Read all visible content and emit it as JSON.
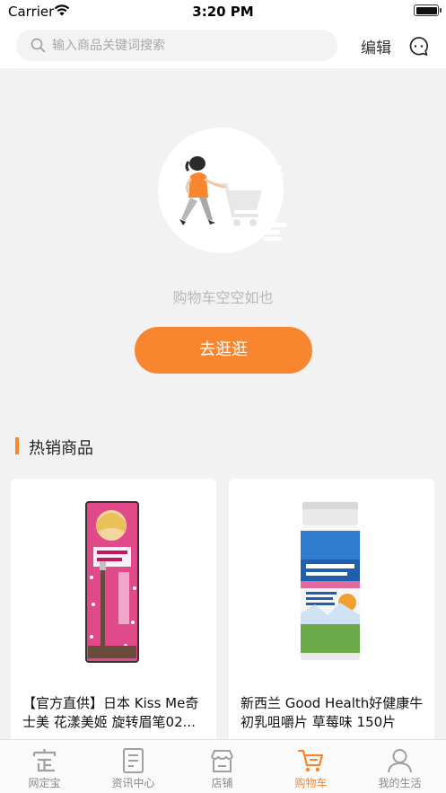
{
  "status_bar": {
    "carrier": "Carrier",
    "time": "3:20 PM"
  },
  "header": {
    "search_placeholder": "输入商品关键词搜索",
    "edit_label": "编辑"
  },
  "empty_cart": {
    "message": "购物车空空如也",
    "button_label": "去逛逛"
  },
  "hot_section": {
    "title": "热销商品",
    "products": [
      {
        "title": "【官方直供】日本 Kiss Me奇士美 花漾美姬 旋转眉笔02..."
      },
      {
        "title": "新西兰 Good Health好健康牛初乳咀嚼片 草莓味 150片"
      }
    ]
  },
  "tab_bar": {
    "tabs": [
      {
        "label": "网定宝",
        "icon": "home-icon",
        "active": false
      },
      {
        "label": "资讯中心",
        "icon": "news-icon",
        "active": false
      },
      {
        "label": "店铺",
        "icon": "store-icon",
        "active": false
      },
      {
        "label": "购物车",
        "icon": "cart-icon",
        "active": true
      },
      {
        "label": "我的生活",
        "icon": "user-icon",
        "active": false
      }
    ]
  },
  "colors": {
    "accent": "#f7862f",
    "background": "#f2f2f2"
  }
}
